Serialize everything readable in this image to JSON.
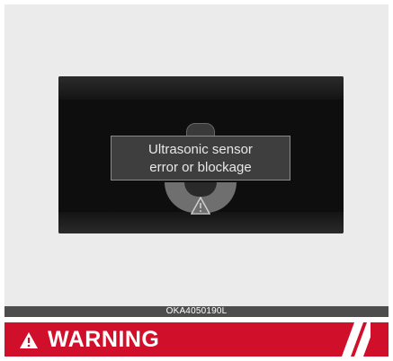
{
  "display": {
    "message_line1": "Ultrasonic sensor",
    "message_line2": "error or blockage",
    "icon": "warning-triangle-icon"
  },
  "caption": "OKA4050190L",
  "warning": {
    "title": "WARNING",
    "icon": "warning-triangle-icon",
    "color": "#d0102a"
  }
}
